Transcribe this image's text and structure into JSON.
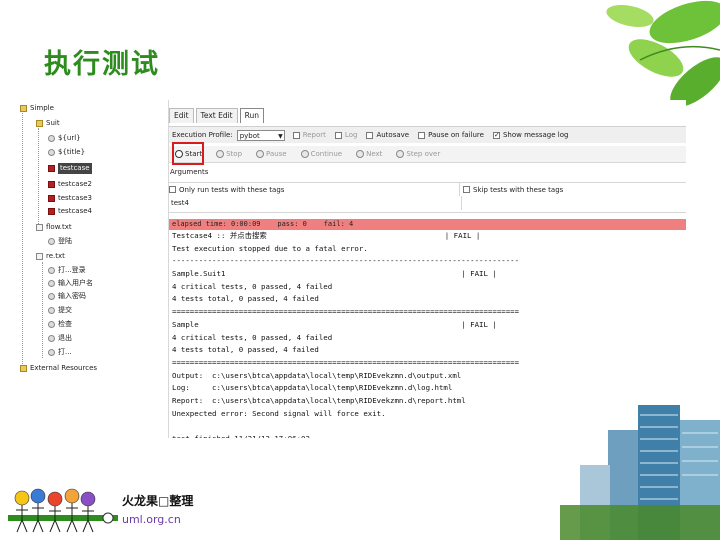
{
  "slide": {
    "title": "执行测试",
    "brand_name": "火龙果□整理",
    "brand_url": "uml.org.cn"
  },
  "tree": {
    "items": [
      {
        "label": "Simple",
        "icon": "project-icon"
      },
      {
        "label": "Suit",
        "icon": "folder-icon"
      },
      {
        "label": "${url}",
        "icon": "variable-icon"
      },
      {
        "label": "${title}",
        "icon": "variable-icon"
      },
      {
        "label": "testcase",
        "icon": "testcase-icon",
        "selected": true
      },
      {
        "label": "testcase2",
        "icon": "testcase-icon"
      },
      {
        "label": "testcase3",
        "icon": "testcase-icon"
      },
      {
        "label": "testcase4",
        "icon": "testcase-icon"
      },
      {
        "label": "flow.txt",
        "icon": "file-icon"
      },
      {
        "label": "登陆",
        "icon": "keyword-icon"
      },
      {
        "label": "re.txt",
        "icon": "file-icon"
      },
      {
        "label": "打...登录",
        "icon": "keyword-icon"
      },
      {
        "label": "输入用户名",
        "icon": "keyword-icon"
      },
      {
        "label": "输入密码",
        "icon": "keyword-icon"
      },
      {
        "label": "提交",
        "icon": "keyword-icon"
      },
      {
        "label": "检查",
        "icon": "keyword-icon"
      },
      {
        "label": "退出",
        "icon": "keyword-icon"
      },
      {
        "label": "打...",
        "icon": "keyword-icon"
      },
      {
        "label": "External Resources",
        "icon": "resources-icon"
      }
    ]
  },
  "tabs": [
    {
      "label": "Edit"
    },
    {
      "label": "Text Edit"
    },
    {
      "label": "Run",
      "active": true
    }
  ],
  "toolbar1": {
    "profile_label": "Execution Profile:",
    "profile_value": "pybot",
    "report_label": "Report",
    "log_label": "Log",
    "autosave_label": "Autosave",
    "pause_label": "Pause on failure",
    "show_message_label": "Show message log"
  },
  "toolbar2": {
    "start": "Start",
    "stop": "Stop",
    "pause": "Pause",
    "continue": "Continue",
    "next": "Next",
    "step_over": "Step over"
  },
  "arguments": {
    "label": "Arguments",
    "only_run_label": "Only run tests with these tags",
    "skip_label": "Skip tests with these tags",
    "only_run_value": "test4",
    "skip_value": ""
  },
  "status_bar": "elapsed time: 0:00:09    pass: 0    fail: 4",
  "output": [
    "Testcase4 :: 并点击搜索                                        | FAIL |",
    "Test execution stopped due to a fatal error.",
    "------------------------------------------------------------------------------",
    "Sample.Suit1                                                     | FAIL |",
    "4 critical tests, 0 passed, 4 failed",
    "4 tests total, 0 passed, 4 failed",
    "==============================================================================",
    "Sample                                                           | FAIL |",
    "4 critical tests, 0 passed, 4 failed",
    "4 tests total, 0 passed, 4 failed",
    "==============================================================================",
    "Output:  c:\\users\\btca\\appdata\\local\\temp\\RIDEvekzmn.d\\output.xml",
    "Log:     c:\\users\\btca\\appdata\\local\\temp\\RIDEvekzmn.d\\log.html",
    "Report:  c:\\users\\btca\\appdata\\local\\temp\\RIDEvekzmn.d\\report.html",
    "Unexpected error: Second signal will force exit.",
    "",
    "test finished 11/21/13 17:06:02"
  ],
  "colors": {
    "title_green": "#2e8b1e",
    "status_fail": "#f08080",
    "highlight_red": "#d71c1c",
    "url_purple": "#6a3aa5"
  }
}
